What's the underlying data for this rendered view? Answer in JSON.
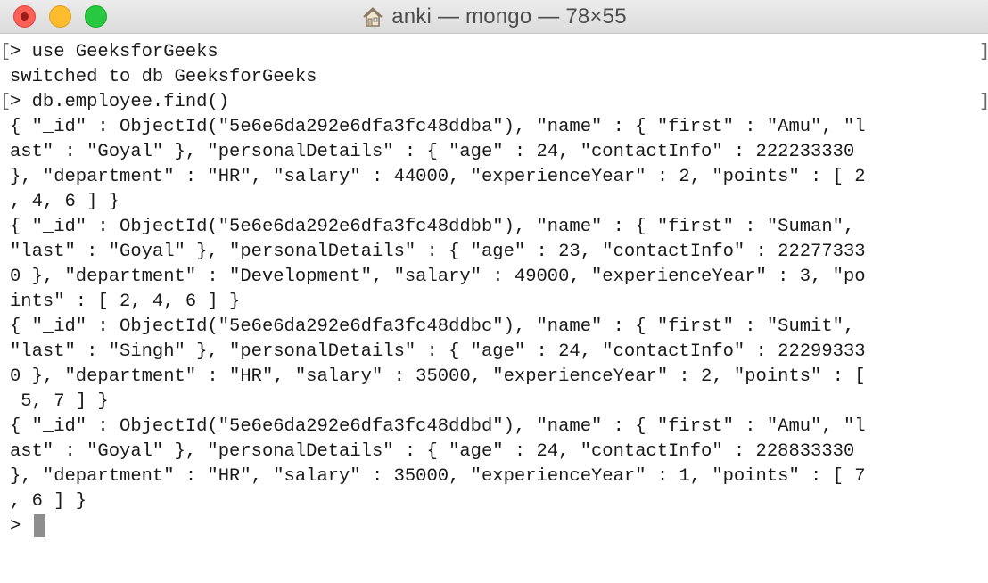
{
  "window": {
    "title": "anki — mongo — 78×55",
    "title_icon": "home-icon",
    "buttons": [
      "close",
      "minimize",
      "zoom"
    ]
  },
  "terminal": {
    "lines": [
      "> use GeeksforGeeks",
      "switched to db GeeksforGeeks",
      "> db.employee.find()",
      "{ \"_id\" : ObjectId(\"5e6e6da292e6dfa3fc48ddba\"), \"name\" : { \"first\" : \"Amu\", \"l",
      "ast\" : \"Goyal\" }, \"personalDetails\" : { \"age\" : 24, \"contactInfo\" : 222233330",
      "}, \"department\" : \"HR\", \"salary\" : 44000, \"experienceYear\" : 2, \"points\" : [ 2",
      ", 4, 6 ] }",
      "{ \"_id\" : ObjectId(\"5e6e6da292e6dfa3fc48ddbb\"), \"name\" : { \"first\" : \"Suman\",",
      "\"last\" : \"Goyal\" }, \"personalDetails\" : { \"age\" : 23, \"contactInfo\" : 22277333",
      "0 }, \"department\" : \"Development\", \"salary\" : 49000, \"experienceYear\" : 3, \"po",
      "ints\" : [ 2, 4, 6 ] }",
      "{ \"_id\" : ObjectId(\"5e6e6da292e6dfa3fc48ddbc\"), \"name\" : { \"first\" : \"Sumit\",",
      "\"last\" : \"Singh\" }, \"personalDetails\" : { \"age\" : 24, \"contactInfo\" : 22299333",
      "0 }, \"department\" : \"HR\", \"salary\" : 35000, \"experienceYear\" : 2, \"points\" : [",
      " 5, 7 ] }",
      "{ \"_id\" : ObjectId(\"5e6e6da292e6dfa3fc48ddbd\"), \"name\" : { \"first\" : \"Amu\", \"l",
      "ast\" : \"Goyal\" }, \"personalDetails\" : { \"age\" : 24, \"contactInfo\" : 228833330",
      "}, \"department\" : \"HR\", \"salary\" : 35000, \"experienceYear\" : 1, \"points\" : [ 7",
      ", 6 ] }",
      ">"
    ],
    "marked_lines": [
      0,
      2
    ],
    "mark_left": "[",
    "mark_right": "]",
    "colors": {
      "background": "#ffffff",
      "text": "#1a1a1a",
      "cursor": "#8e8e8e"
    }
  }
}
